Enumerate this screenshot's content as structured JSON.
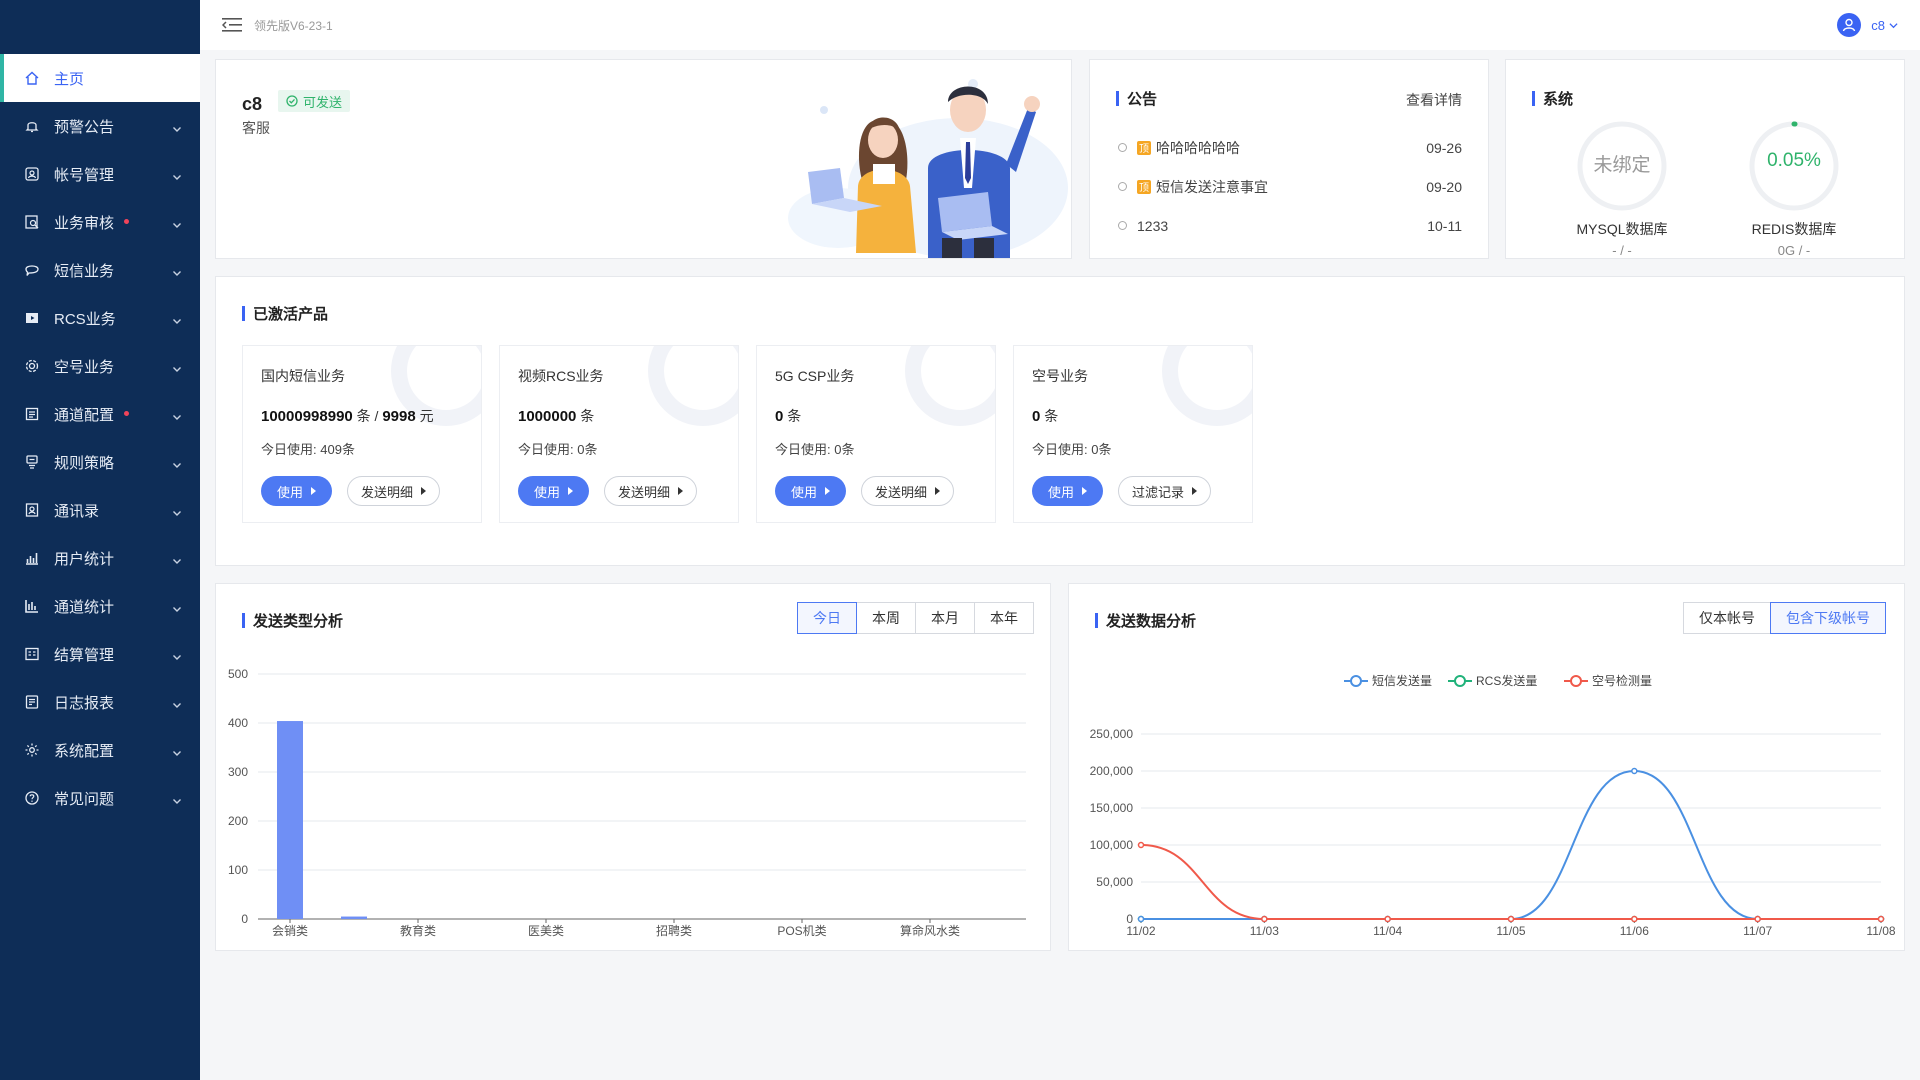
{
  "topbar": {
    "version": "领先版V6-23-1",
    "user": "c8"
  },
  "sidebar": {
    "items": [
      {
        "label": "主页",
        "icon": "home-icon",
        "active": true,
        "dot": false
      },
      {
        "label": "预警公告",
        "icon": "bell-icon",
        "dot": false
      },
      {
        "label": "帐号管理",
        "icon": "user-card-icon",
        "dot": false
      },
      {
        "label": "业务审核",
        "icon": "audit-icon",
        "dot": true
      },
      {
        "label": "短信业务",
        "icon": "chat-icon",
        "dot": false
      },
      {
        "label": "RCS业务",
        "icon": "media-icon",
        "dot": false
      },
      {
        "label": "空号业务",
        "icon": "gear-icon",
        "dot": false
      },
      {
        "label": "通道配置",
        "icon": "channel-icon",
        "dot": true
      },
      {
        "label": "规则策略",
        "icon": "rule-icon",
        "dot": false
      },
      {
        "label": "通讯录",
        "icon": "contacts-icon",
        "dot": false
      },
      {
        "label": "用户统计",
        "icon": "bar-stats-icon",
        "dot": false
      },
      {
        "label": "通道统计",
        "icon": "column-stats-icon",
        "dot": false
      },
      {
        "label": "结算管理",
        "icon": "settle-icon",
        "dot": false
      },
      {
        "label": "日志报表",
        "icon": "log-icon",
        "dot": false
      },
      {
        "label": "系统配置",
        "icon": "settings-icon",
        "dot": false
      },
      {
        "label": "常见问题",
        "icon": "help-icon",
        "dot": false
      }
    ]
  },
  "profile": {
    "name": "c8",
    "status": "可发送",
    "role": "客服"
  },
  "notice": {
    "title": "公告",
    "more": "查看详情",
    "items": [
      {
        "tag": "顶",
        "title": "哈哈哈哈哈哈",
        "date": "09-26",
        "pinned": true
      },
      {
        "tag": "顶",
        "title": "短信发送注意事宜",
        "date": "09-20",
        "pinned": true
      },
      {
        "tag": "",
        "title": "1233",
        "date": "10-11",
        "pinned": false
      }
    ]
  },
  "system": {
    "title": "系统",
    "mysql": {
      "value": "未绑定",
      "name": "MYSQL数据库",
      "sub": "- / -"
    },
    "redis": {
      "value": "0.05%",
      "percent": 0.05,
      "name": "REDIS数据库",
      "sub": "0G / -"
    },
    "colors": {
      "ok": "#2fb36b",
      "unbound": "#999999"
    }
  },
  "products": {
    "title": "已激活产品",
    "items": [
      {
        "name": "国内短信业务",
        "count": "10000998990",
        "unit": "条",
        "sep": "/",
        "money": "9998",
        "money_unit": "元",
        "today_label": "今日使用:",
        "today_value": "409条",
        "use": "使用",
        "detail": "发送明细"
      },
      {
        "name": "视频RCS业务",
        "count": "1000000",
        "unit": "条",
        "today_label": "今日使用:",
        "today_value": "0条",
        "use": "使用",
        "detail": "发送明细"
      },
      {
        "name": "5G CSP业务",
        "count": "0",
        "unit": "条",
        "today_label": "今日使用:",
        "today_value": "0条",
        "use": "使用",
        "detail": "发送明细"
      },
      {
        "name": "空号业务",
        "count": "0",
        "unit": "条",
        "today_label": "今日使用:",
        "today_value": "0条",
        "use": "使用",
        "detail": "过滤记录"
      }
    ]
  },
  "type_analysis": {
    "title": "发送类型分析",
    "tabs": [
      "今日",
      "本周",
      "本月",
      "本年"
    ],
    "active_tab": 0
  },
  "data_analysis": {
    "title": "发送数据分析",
    "tabs": [
      "仅本帐号",
      "包含下级帐号"
    ],
    "active_tab": 1
  },
  "chart_data": [
    {
      "type": "bar",
      "categories": [
        "会销类",
        "",
        "教育类",
        "",
        "医美类",
        "",
        "招聘类",
        "",
        "POS机类",
        "",
        "算命风水类",
        ""
      ],
      "values": [
        404,
        5,
        0,
        0,
        0,
        0,
        0,
        0,
        0,
        0,
        0,
        0
      ],
      "tick_labels": [
        "会销类",
        "教育类",
        "医美类",
        "招聘类",
        "POS机类",
        "算命风水类"
      ],
      "ylim": [
        0,
        500
      ],
      "yticks": [
        0,
        100,
        200,
        300,
        400,
        500
      ],
      "color": "#6f8ff5",
      "grid": true
    },
    {
      "type": "line",
      "x": [
        "11/02",
        "11/03",
        "11/04",
        "11/05",
        "11/06",
        "11/07",
        "11/08"
      ],
      "ylim": [
        0,
        250000
      ],
      "yticks": [
        "0",
        "50,000",
        "100,000",
        "150,000",
        "200,000",
        "250,000"
      ],
      "legend_position": "top-center",
      "series": [
        {
          "name": "短信发送量",
          "color": "#4a90e2",
          "values": [
            0,
            0,
            0,
            0,
            200000,
            0,
            0
          ]
        },
        {
          "name": "RCS发送量",
          "color": "#20b27a",
          "values": [
            0,
            0,
            0,
            0,
            0,
            0,
            0
          ]
        },
        {
          "name": "空号检测量",
          "color": "#f0594a",
          "values": [
            100000,
            0,
            0,
            0,
            0,
            0,
            0
          ]
        }
      ],
      "grid": true
    }
  ]
}
